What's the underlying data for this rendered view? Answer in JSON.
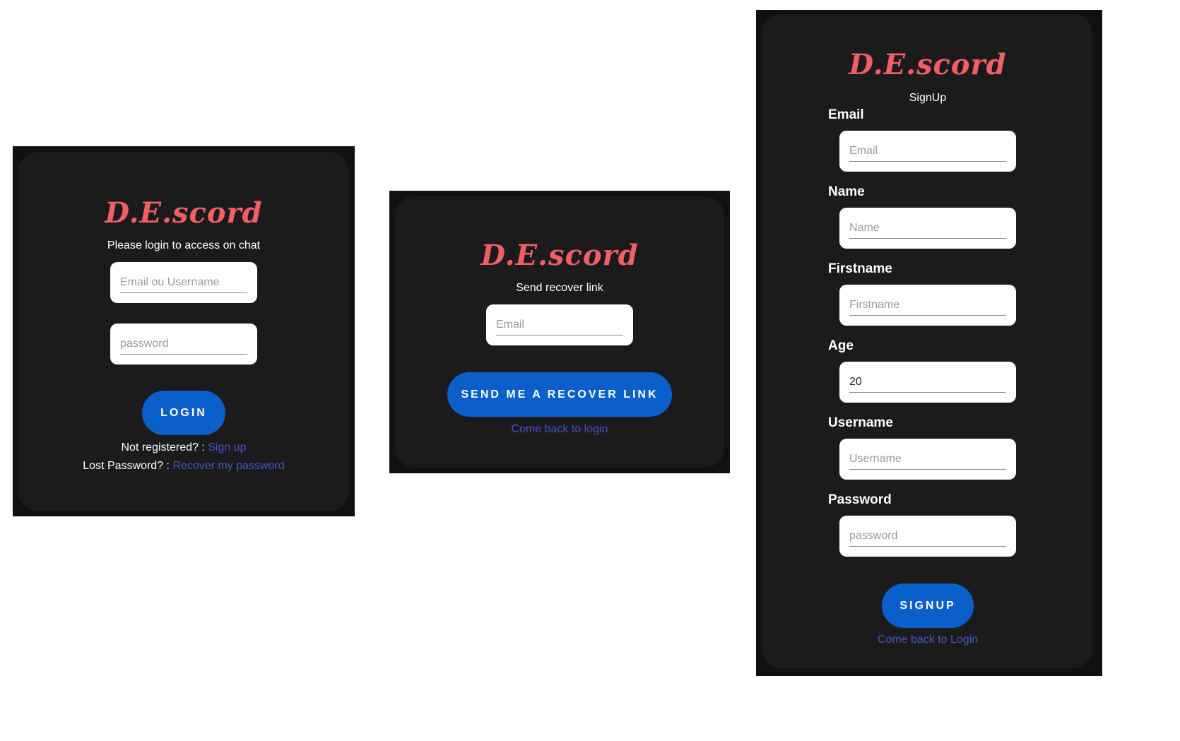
{
  "brand": "D.E.scord",
  "login": {
    "subtitle": "Please login to access on chat",
    "email_placeholder": "Email ou Username",
    "password_placeholder": "password",
    "login_button": "LOGIN",
    "not_registered_text": "Not registered? :",
    "signup_link": "Sign up",
    "lost_password_text": "Lost Password? :",
    "recover_link": "Recover my password"
  },
  "recover": {
    "subtitle": "Send recover link",
    "email_placeholder": "Email",
    "send_button": "SEND ME A RECOVER LINK",
    "back_link": "Come back to login"
  },
  "signup": {
    "subtitle": "SignUp",
    "fields": [
      {
        "label": "Email",
        "placeholder": "Email",
        "value": ""
      },
      {
        "label": "Name",
        "placeholder": "Name",
        "value": ""
      },
      {
        "label": "Firstname",
        "placeholder": "Firstname",
        "value": ""
      },
      {
        "label": "Age",
        "placeholder": "",
        "value": "20"
      },
      {
        "label": "Username",
        "placeholder": "Username",
        "value": ""
      },
      {
        "label": "Password",
        "placeholder": "password",
        "value": ""
      }
    ],
    "signup_button": "SIGNUP",
    "back_link": "Come back to Login"
  },
  "colors": {
    "brand": "#ef5f63",
    "button": "#0b5fcb",
    "link": "#4554c8",
    "panel": "#1b1b1c"
  }
}
